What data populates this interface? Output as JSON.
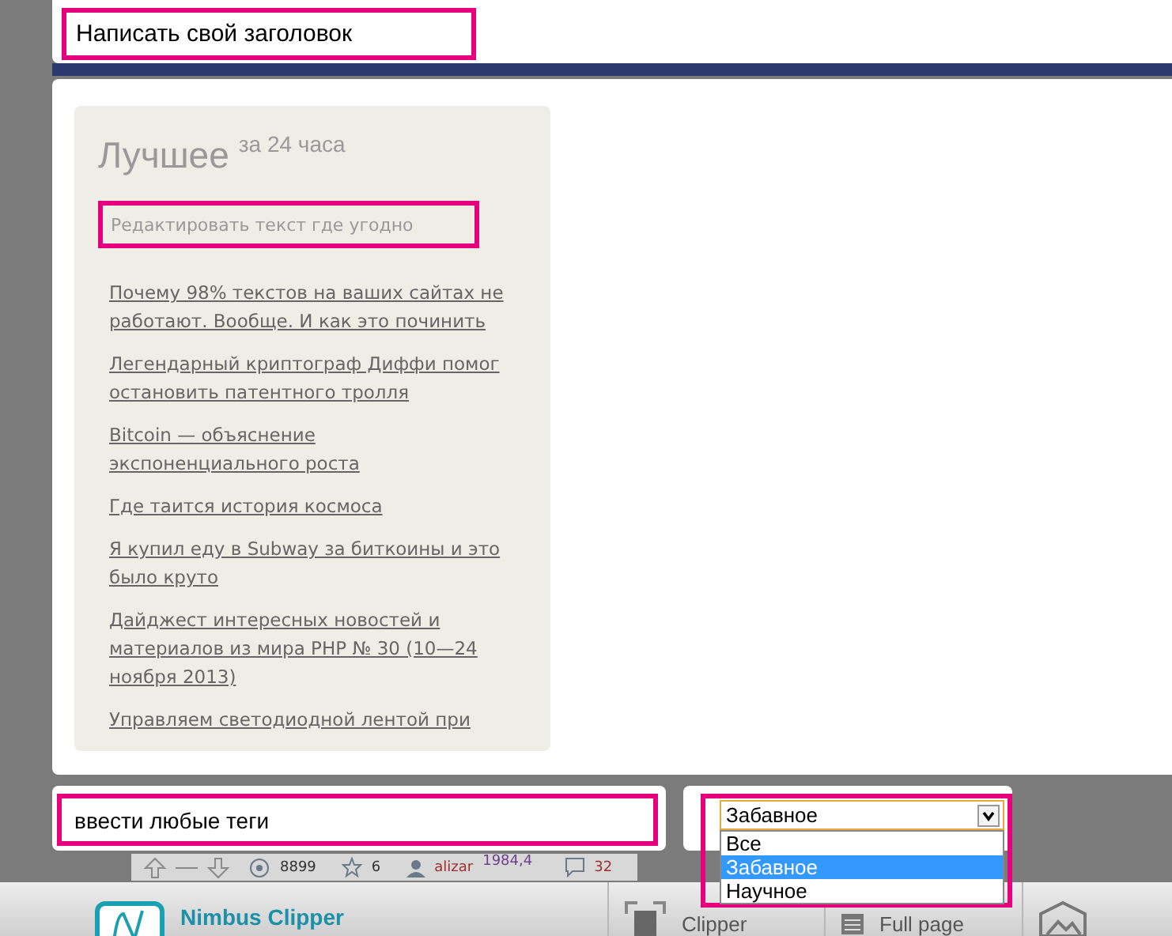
{
  "title_field": {
    "value": "Написать свой заголовок"
  },
  "sidebar": {
    "heading": "Лучшее",
    "heading_note": "за 24 часа",
    "edit_field": {
      "placeholder": "Редактировать текст где угодно"
    },
    "links": [
      "Почему 98% текстов на ваших сайтах не работают. Вообще. И как это починить",
      "Легендарный криптограф Диффи помог остановить патентного тролля",
      "Bitcoin — объяснение экспоненциального роста",
      "Где таится история космоса",
      "Я купил еду в Subway за биткоины и это было круто",
      "Дайджест интересных новостей и материалов из мира PHP № 30 (10—24 ноября 2013)",
      "Управляем светодиодной лентой при"
    ]
  },
  "tags_field": {
    "value": "ввести любые теги"
  },
  "category_select": {
    "value": "Забавное",
    "options": [
      {
        "label": "Все",
        "selected": false
      },
      {
        "label": "Забавное",
        "selected": true
      },
      {
        "label": "Научное",
        "selected": false
      }
    ]
  },
  "post_stats": {
    "views": "8899",
    "favorites": "6",
    "author": "alizar",
    "karma": "1984,4",
    "comments": "32"
  },
  "toolbar": {
    "app_name": "Nimbus Clipper",
    "buttons": [
      "Clipper",
      "Full page"
    ]
  }
}
